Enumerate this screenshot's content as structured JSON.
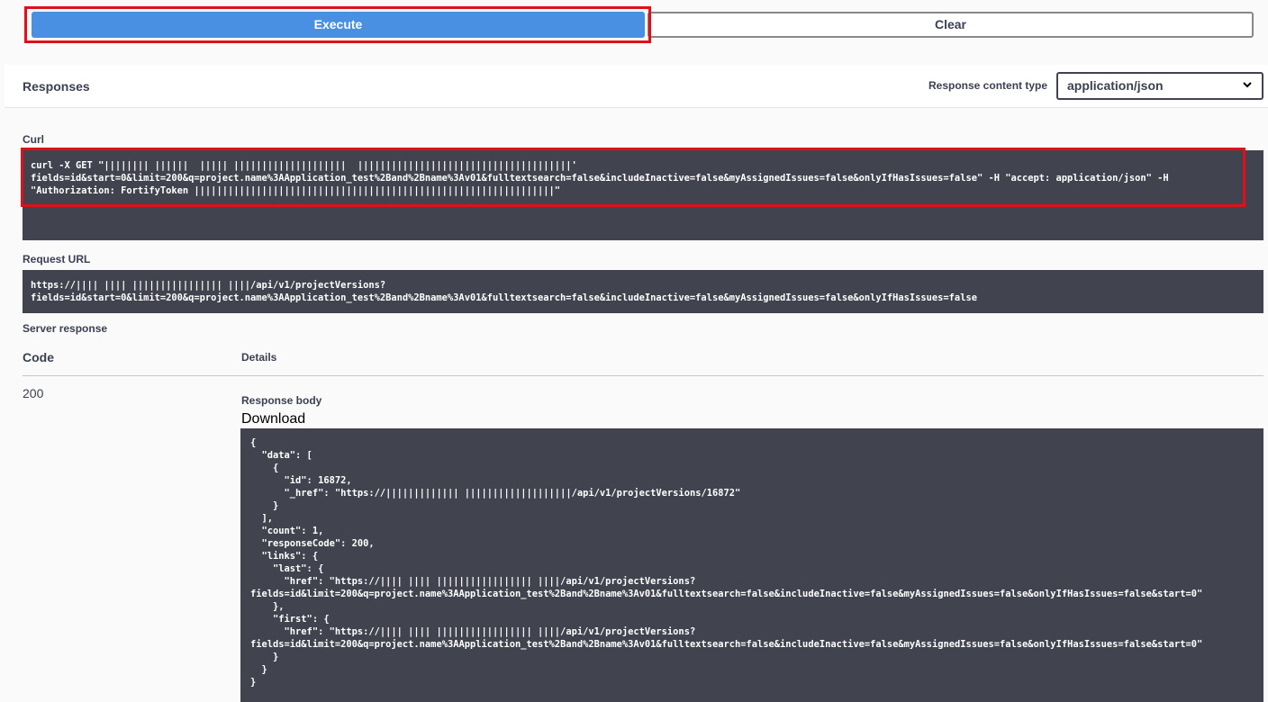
{
  "buttons": {
    "execute": "Execute",
    "clear": "Clear"
  },
  "responses": {
    "title": "Responses",
    "content_type_label": "Response content type",
    "content_type_value": "application/json"
  },
  "curl": {
    "label": "Curl",
    "text": "curl -X GET \"|||||||| ||||||  ||||| ||||||||||||||||||||  ||||||||||||||||||||||||||||||||||||||'\nfields=id&start=0&limit=200&q=project.name%3AApplication_test%2Band%2Bname%3Av01&fulltextsearch=false&includeInactive=false&myAssignedIssues=false&onlyIfHasIssues=false\" -H \"accept: application/json\" -H\n\"Authorization: FortifyToken ||||||||||||||||||||||||||||||||||||||||||||||||||||||||||||||||\""
  },
  "request_url": {
    "label": "Request URL",
    "text": "https://|||| |||| |||||||||||||||| ||||/api/v1/projectVersions?\nfields=id&start=0&limit=200&q=project.name%3AApplication_test%2Band%2Bname%3Av01&fulltextsearch=false&includeInactive=false&myAssignedIssues=false&onlyIfHasIssues=false"
  },
  "server_response": {
    "label": "Server response",
    "code_header": "Code",
    "details_header": "Details",
    "code": "200",
    "response_body_label": "Response body",
    "download_label": "Download",
    "body": "{\n  \"data\": [\n    {\n      \"id\": 16872,\n      \"_href\": \"https://||||||||||||| |||||||||||||||||||/api/v1/projectVersions/16872\"\n    }\n  ],\n  \"count\": 1,\n  \"responseCode\": 200,\n  \"links\": {\n    \"last\": {\n      \"href\": \"https://|||| |||| ||||||||||||||||| ||||/api/v1/projectVersions?\nfields=id&limit=200&q=project.name%3AApplication_test%2Band%2Bname%3Av01&fulltextsearch=false&includeInactive=false&myAssignedIssues=false&onlyIfHasIssues=false&start=0\"\n    },\n    \"first\": {\n      \"href\": \"https://|||| |||| ||||||||||||||||| ||||/api/v1/projectVersions?\nfields=id&limit=200&q=project.name%3AApplication_test%2Band%2Bname%3Av01&fulltextsearch=false&includeInactive=false&myAssignedIssues=false&onlyIfHasIssues=false&start=0\"\n    }\n  }\n}"
  },
  "colors": {
    "execute_bg": "#4990e2",
    "code_bg": "#41444e",
    "highlight": "#e0101a"
  },
  "icons": {
    "select_chevron": "chevron-down-icon"
  }
}
